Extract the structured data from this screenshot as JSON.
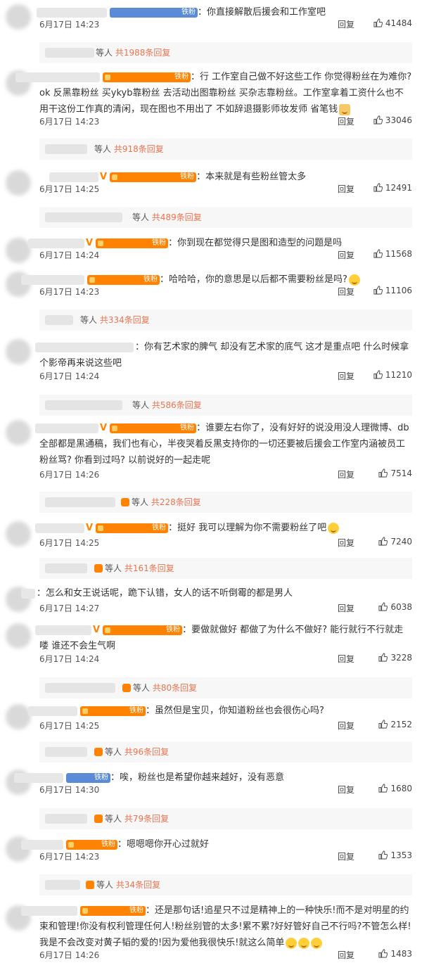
{
  "feed": {
    "reply_label": "回复",
    "more_word": "等人",
    "comments": [
      {
        "badge": "铁粉",
        "badge_style": "blue",
        "vip": false,
        "text": "你直接解散后援会和工作室吧",
        "emoji": "",
        "time": "6月17日 14:23",
        "likes": "41484",
        "summary_count": "共1988条回复",
        "summary_badge": false
      },
      {
        "badge": "铁粉",
        "badge_style": "orange",
        "vip": false,
        "text": "行 工作室自己做不好这些工作 你觉得粉丝在为难你? ok 反黑靠粉丝 买ykyb靠粉丝 去活动出图靠粉丝 买杂志靠粉丝。工作室拿着工资什么也不用干这份工作真的清闲，现在图也不用出了 不如辞退摄影师妆发师 省笔钱",
        "emoji": "thumbs-up",
        "time": "6月17日 14:23",
        "likes": "33046",
        "summary_count": "共918条回复",
        "summary_badge": false
      },
      {
        "badge": "铁粉",
        "badge_style": "orange",
        "vip": true,
        "text": "本来就是有些粉丝管太多",
        "emoji": "",
        "time": "6月17日 14:25",
        "likes": "12491",
        "summary_count": "共489条回复",
        "summary_badge": false
      },
      {
        "badge": "铁粉",
        "badge_style": "orange",
        "vip": true,
        "text": "你到现在都觉得只是图和造型的问题是吗",
        "emoji": "",
        "time": "6月17日 14:24",
        "likes": "11568",
        "summary_count": "",
        "summary_badge": false
      },
      {
        "badge": "铁粉",
        "badge_style": "orange",
        "vip": false,
        "text": "哈哈哈，你的意思是以后都不需要粉丝是吗?",
        "emoji": "smile",
        "time": "6月17日 14:23",
        "likes": "11106",
        "summary_count": "共334条回复",
        "summary_badge": false
      },
      {
        "badge": "",
        "badge_style": "",
        "vip": false,
        "text": "你有艺术家的脾气 却没有艺术家的底气 这才是重点吧 什么时候拿个影帝再来说这些吧",
        "emoji": "",
        "time": "6月17日 14:24",
        "likes": "11210",
        "summary_count": "共586条回复",
        "summary_badge": false
      },
      {
        "badge": "铁粉",
        "badge_style": "orange",
        "vip": true,
        "text": "谁要左右你了，没有好好的说没用没人理微博、db全部都是黑通稿，我们也有心，半夜哭着反黑支持你的一切还要被后援会工作室内涵被员工粉丝骂? 你看到过吗? 以前说好的一起走呢",
        "emoji": "",
        "time": "6月17日 14:26",
        "likes": "7514",
        "summary_count": "共228条回复",
        "summary_badge": true
      },
      {
        "badge": "铁粉",
        "badge_style": "orange",
        "vip": true,
        "text": "挺好 我可以理解为你不需要粉丝了吧",
        "emoji": "smile",
        "time": "6月17日 14:25",
        "likes": "7240",
        "summary_count": "共161条回复",
        "summary_badge": true
      },
      {
        "badge": "",
        "badge_style": "",
        "vip": false,
        "text": "怎么和女王说话呢，跪下认错，女人的话不听倒霉的都是男人",
        "emoji": "",
        "time": "6月17日 14:27",
        "likes": "6038",
        "summary_count": "",
        "summary_badge": false
      },
      {
        "badge": "铁粉",
        "badge_style": "orange",
        "vip": true,
        "text": "要做就做好 都做了为什么不做好? 能行就行不行就走喽 谁还不会生气啊",
        "emoji": "",
        "time": "6月17日 14:24",
        "likes": "3228",
        "summary_count": "共80条回复",
        "summary_badge": true
      },
      {
        "badge": "铁粉",
        "badge_style": "orange",
        "vip": false,
        "text": "虽然但是宝贝，你知道粉丝也会很伤心吗?",
        "emoji": "",
        "time": "6月17日 14:25",
        "likes": "2152",
        "summary_count": "共96条回复",
        "summary_badge": true
      },
      {
        "badge": "铁粉",
        "badge_style": "blue",
        "vip": false,
        "text": "唉，粉丝也是希望你越来越好，没有恶意",
        "emoji": "",
        "time": "6月17日 14:30",
        "likes": "1680",
        "summary_count": "共79条回复",
        "summary_badge": true
      },
      {
        "badge": "铁粉",
        "badge_style": "orange",
        "vip": false,
        "text": "嗯嗯嗯你开心过就好",
        "emoji": "",
        "time": "6月17日 14:23",
        "likes": "1353",
        "summary_count": "共34条回复",
        "summary_badge": true
      },
      {
        "badge": "铁粉",
        "badge_style": "orange",
        "vip": false,
        "text": "还是那句话!追星只不过是精神上的一种快乐!而不是对明星的约束和管理!你没有权利管理任何人!粉丝别管的太多!累不累?好好管好自己不行吗?不管怎么样!我是不会改变对黄子韬的爱的!因为爱他我很快乐!就这么简单",
        "emoji": "kiss3",
        "time": "6月17日 14:26",
        "likes": "1483",
        "summary_count": "",
        "summary_badge": false
      }
    ]
  }
}
